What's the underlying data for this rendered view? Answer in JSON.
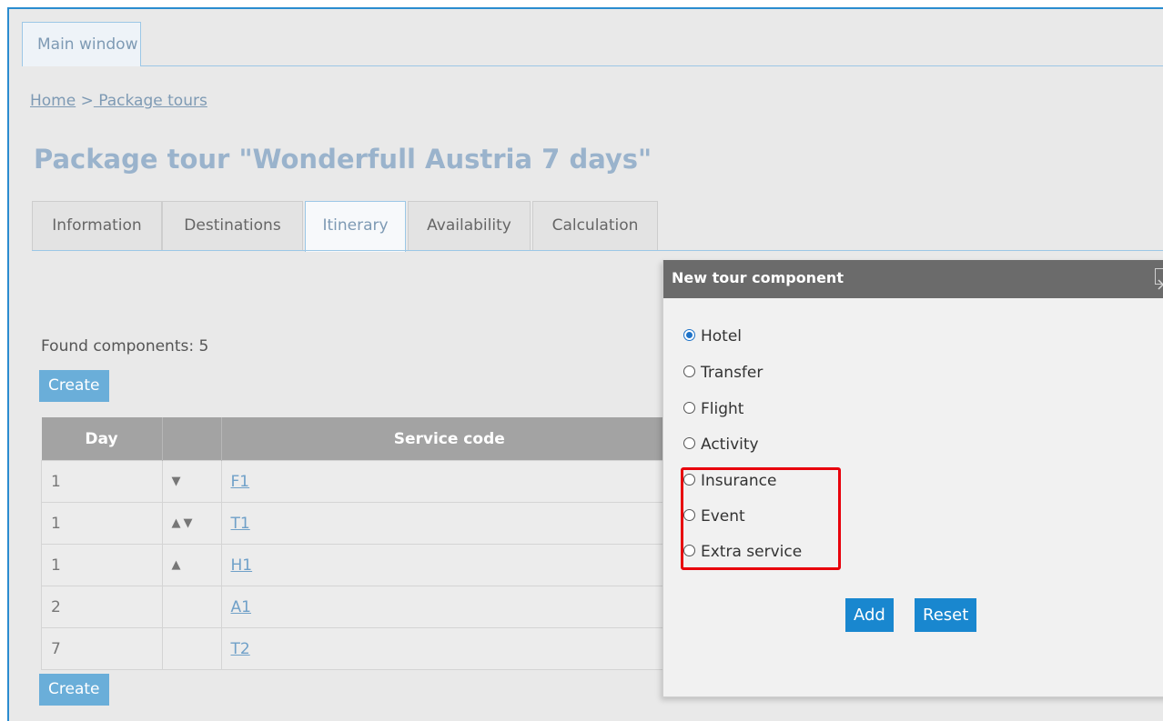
{
  "window_tab": "Main window",
  "breadcrumb": {
    "home": "Home",
    "separator": ">",
    "current": " Package tours"
  },
  "page_title": "Package tour \"Wonderfull Austria 7 days\"",
  "tabs": [
    "Information",
    "Destinations",
    "Itinerary",
    "Availability",
    "Calculation"
  ],
  "active_tab": "Itinerary",
  "found_text": "Found components: 5",
  "create_label": "Create",
  "table": {
    "headers": {
      "day": "Day",
      "order": "",
      "service_code": "Service code"
    },
    "rows": [
      {
        "day": "1",
        "arrows": "▼",
        "code": "F1"
      },
      {
        "day": "1",
        "arrows": "▲▼",
        "code": "T1"
      },
      {
        "day": "1",
        "arrows": "▲",
        "code": "H1"
      },
      {
        "day": "2",
        "arrows": "",
        "code": "A1"
      },
      {
        "day": "7",
        "arrows": "",
        "code": "T2"
      }
    ]
  },
  "modal": {
    "title": "New tour component",
    "options": [
      "Hotel",
      "Transfer",
      "Flight",
      "Activity",
      "Insurance",
      "Event",
      "Extra service"
    ],
    "selected": "Hotel",
    "add_label": "Add",
    "reset_label": "Reset"
  },
  "colors": {
    "accent": "#1987cf",
    "highlight": "#e8000b",
    "title": "#9ab3cc"
  }
}
